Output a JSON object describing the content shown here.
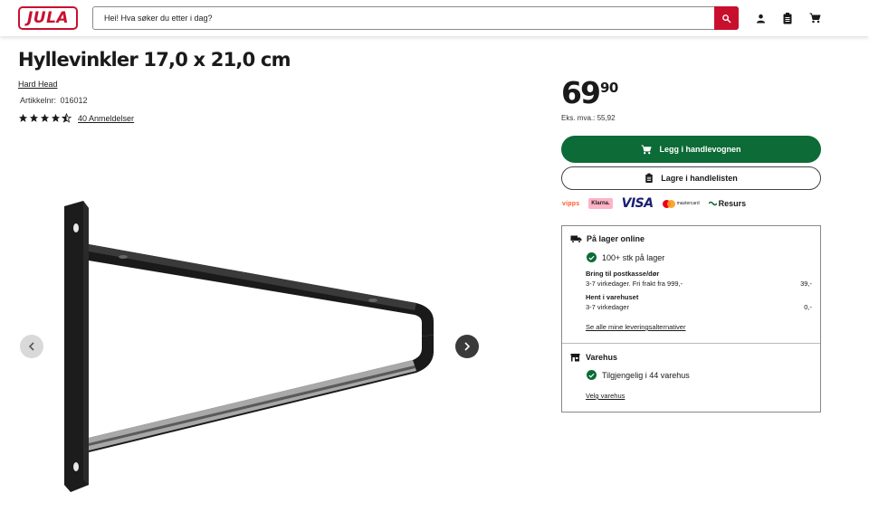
{
  "header": {
    "logo_text": "JULA",
    "search_placeholder": "Hei! Hva søker du etter i dag?",
    "icons": [
      "search-icon",
      "account-icon",
      "shopping-list-icon",
      "cart-icon"
    ]
  },
  "product": {
    "title": "Hyllevinkler 17,0 x 21,0 cm",
    "brand": "Hard Head",
    "article_label": "Artikkelnr:",
    "article_number": "016012",
    "rating": 4.5,
    "reviews_label": "40 Anmeldelser"
  },
  "price": {
    "main": "69",
    "decimals": "90",
    "ex_vat": "Eks. mva.: 55,92"
  },
  "buttons": {
    "add_to_cart": "Legg i handlevognen",
    "save_to_list": "Lagre i handlelisten"
  },
  "payments": {
    "vipps": "vipps",
    "klarna": "Klarna.",
    "visa": "VISA",
    "mastercard": "mastercard",
    "resurs": "Resurs"
  },
  "availability": {
    "online_title": "På lager online",
    "online_stock": "100+ stk på lager",
    "post_title": "Bring til postkasse/dør",
    "post_detail": "3-7 virkedager. Fri frakt fra 999,-",
    "post_price": "39,-",
    "pickup_title": "Hent i varehuset",
    "pickup_detail": "3-7 virkedager",
    "pickup_price": "0,-",
    "delivery_link": "Se alle mine leveringsalternativer",
    "store_title": "Varehus",
    "store_stock": "Tilgjengelig i 44 varehus",
    "store_link": "Velg varehus"
  },
  "colors": {
    "brand_red": "#c8102e",
    "cta_green": "#0c6b36"
  }
}
